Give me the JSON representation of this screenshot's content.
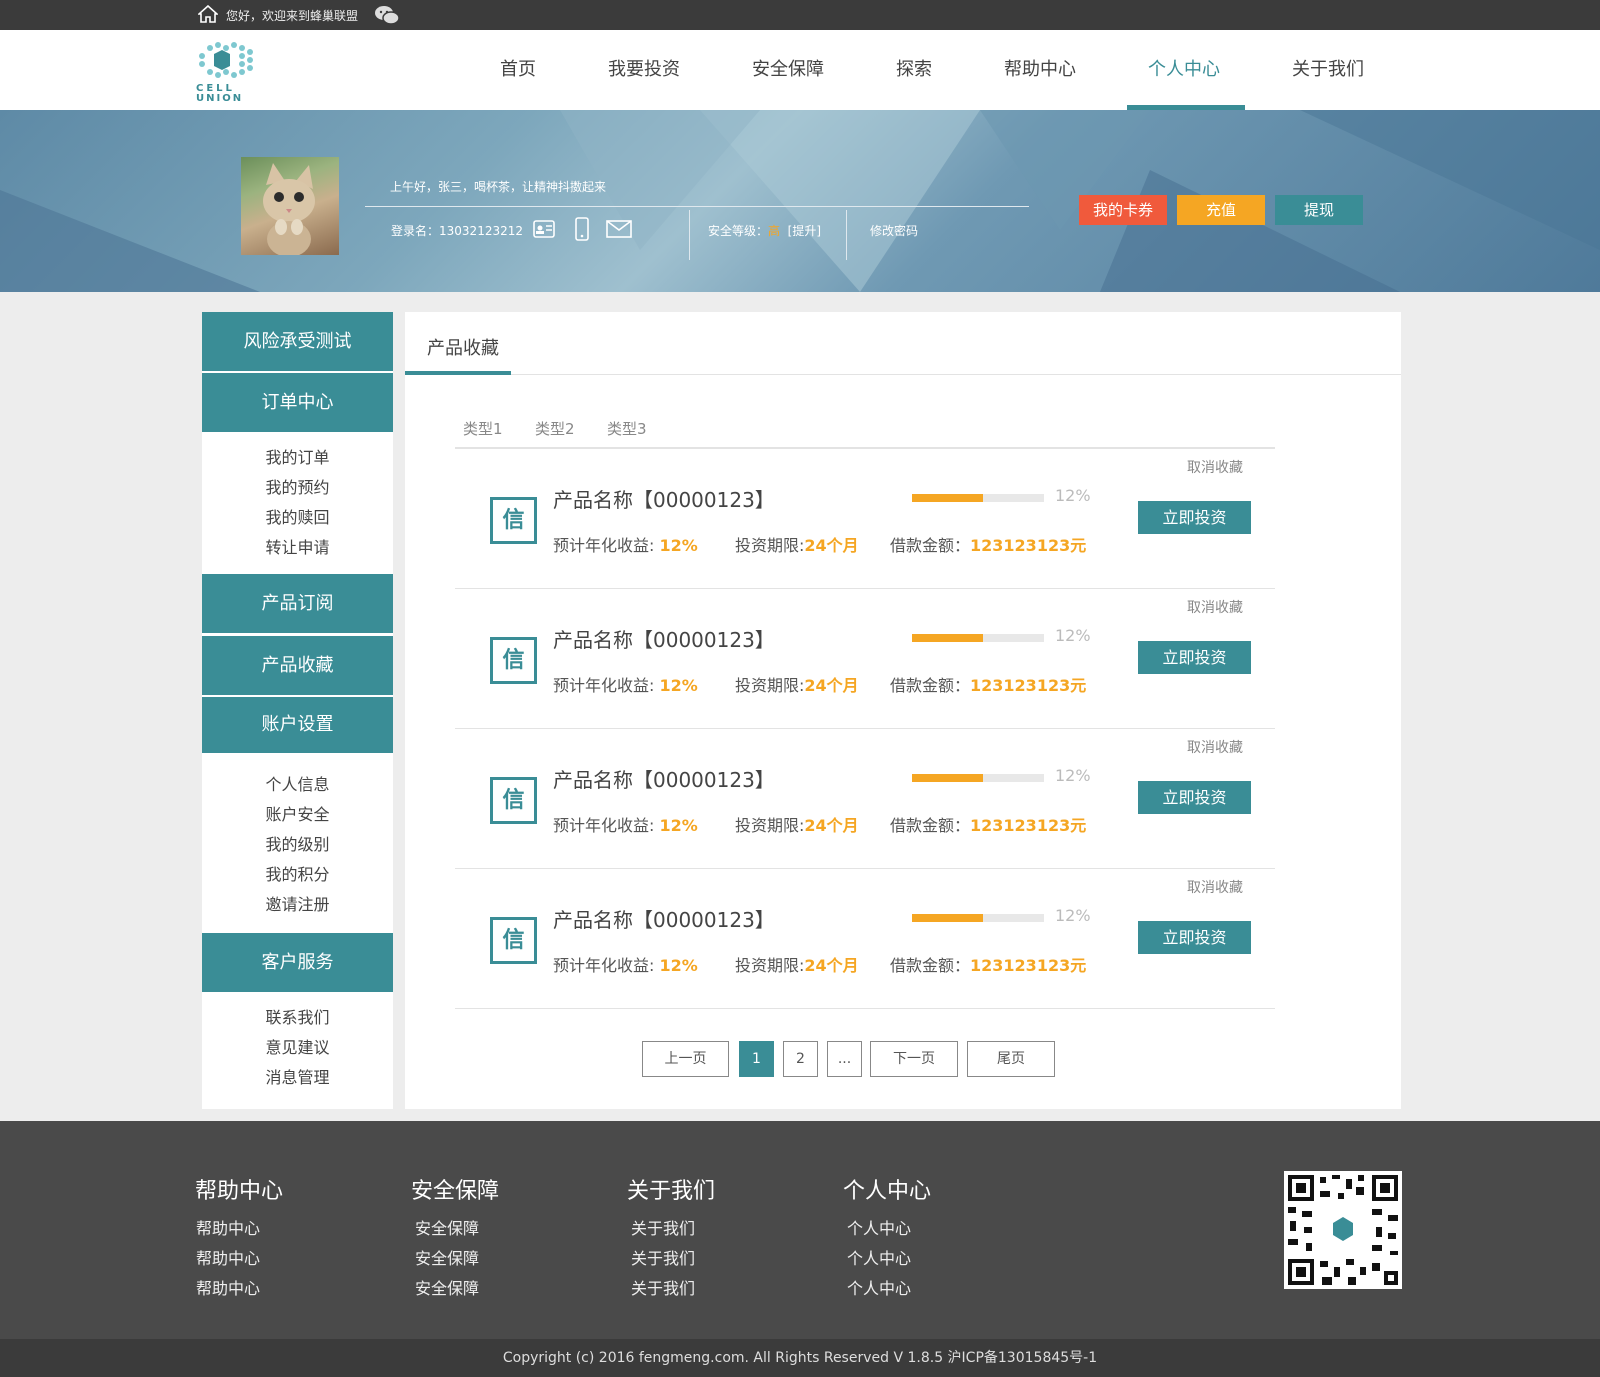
{
  "topbar": {
    "greeting": "您好，欢迎来到蜂巢联盟"
  },
  "logo": {
    "line1": "CELL",
    "line2": "UNION"
  },
  "nav": [
    "首页",
    "我要投资",
    "安全保障",
    "探索",
    "帮助中心",
    "个人中心",
    "关于我们"
  ],
  "nav_active": "个人中心",
  "profile": {
    "welcome": "上午好，张三，喝杯茶，让精神抖擞起来",
    "login_label": "登录名：",
    "login_value": "13032123212",
    "security_label": "安全等级：",
    "security_level": "高",
    "security_upgrade": "[提升]",
    "change_password": "修改密码",
    "buttons": {
      "coupon": "我的卡券",
      "recharge": "充值",
      "withdraw": "提现"
    }
  },
  "sidebar": {
    "risk_test": "风险承受测试",
    "orders": {
      "title": "订单中心",
      "items": [
        "我的订单",
        "我的预约",
        "我的赎回",
        "转让申请"
      ]
    },
    "subscribe": "产品订阅",
    "favorites": "产品收藏",
    "account": {
      "title": "账户设置",
      "items": [
        "个人信息",
        "账户安全",
        "我的级别",
        "我的积分",
        "邀请注册"
      ]
    },
    "service": {
      "title": "客户服务",
      "items": [
        "联系我们",
        "意见建议",
        "消息管理"
      ]
    }
  },
  "main": {
    "tab": "产品收藏",
    "filters": [
      "类型1",
      "类型2",
      "类型3"
    ],
    "products": [
      {
        "icon": "信",
        "name": "产品名称【00000123】",
        "progress": 0.54,
        "percent": "12%",
        "cancel": "取消收藏",
        "yield_label": "预计年化收益:",
        "yield": "12%",
        "term_label": "投资期限:",
        "term": "24个月",
        "amount_label": "借款金额：",
        "amount": "123123123元",
        "button": "立即投资"
      },
      {
        "icon": "信",
        "name": "产品名称【00000123】",
        "progress": 0.54,
        "percent": "12%",
        "cancel": "取消收藏",
        "yield_label": "预计年化收益:",
        "yield": "12%",
        "term_label": "投资期限:",
        "term": "24个月",
        "amount_label": "借款金额：",
        "amount": "123123123元",
        "button": "立即投资"
      },
      {
        "icon": "信",
        "name": "产品名称【00000123】",
        "progress": 0.54,
        "percent": "12%",
        "cancel": "取消收藏",
        "yield_label": "预计年化收益:",
        "yield": "12%",
        "term_label": "投资期限:",
        "term": "24个月",
        "amount_label": "借款金额：",
        "amount": "123123123元",
        "button": "立即投资"
      },
      {
        "icon": "信",
        "name": "产品名称【00000123】",
        "progress": 0.54,
        "percent": "12%",
        "cancel": "取消收藏",
        "yield_label": "预计年化收益:",
        "yield": "12%",
        "term_label": "投资期限:",
        "term": "24个月",
        "amount_label": "借款金额：",
        "amount": "123123123元",
        "button": "立即投资"
      }
    ],
    "pagination": {
      "prev": "上一页",
      "pages": [
        "1",
        "2",
        "..."
      ],
      "current": "1",
      "next": "下一页",
      "last": "尾页"
    }
  },
  "footer": {
    "columns": [
      {
        "title": "帮助中心",
        "items": [
          "帮助中心",
          "帮助中心",
          "帮助中心"
        ]
      },
      {
        "title": "安全保障",
        "items": [
          "安全保障",
          "安全保障",
          "安全保障"
        ]
      },
      {
        "title": "关于我们",
        "items": [
          "关于我们",
          "关于我们",
          "关于我们"
        ]
      },
      {
        "title": "个人中心",
        "items": [
          "个人中心",
          "个人中心",
          "个人中心"
        ]
      }
    ],
    "copyright": "Copyright (c) 2016 fengmeng.com. All Rights Reserved V 1.8.5 沪ICP备13015845号-1"
  },
  "colors": {
    "teal": "#3a8d96",
    "orange": "#f5a623",
    "red": "#f05a3c",
    "footer": "#4a4a4a"
  }
}
